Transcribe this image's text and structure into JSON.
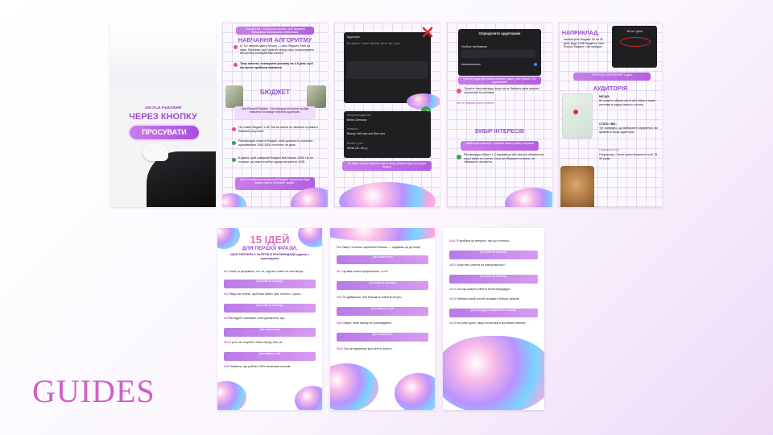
{
  "footer_title": "GUIDES",
  "card1": {
    "line1": "ЗАПУСК РЕКЛАМИ",
    "line2": "ЧЕРЕЗ КНОПКУ",
    "button": "ПРОСУВАТИ"
  },
  "card2": {
    "top_pill": "Сьогодні ми з тобою розглянемо, щоб кампанія працювала максимально ефективно",
    "heading1": "НАВЧАННЯ АЛГОРИТМУ",
    "item1": "A. Тут звернім увагу на ціну — ціна, бюджет, і вся ця сума. Можливо, щоб довгий період часу налаштування алгоритму показуватиме оплату.",
    "item2": "Тому змінити, показувати рекламу на 4-5 днів, щоб алгоритм пройшов навчання.",
    "heading2": "БЮДЖЕТ",
    "note": "Чим більший бюджет - тим швидше алгоритм пройде навчання та знайде потрібну аудиторію.",
    "item3": "Не ставте бюджет 1-2$. Так ви ніколи не зможете отримати бажаний результат.",
    "item4": "Рекомендую ставити бюджет, який дозволить отримати щонайменше 1500-3000 охоплень на день.",
    "item5": "В ідеалі, щоб сумарний бюджет був більше 100$. Це не означає, що вам потрібно одразу витратити 100$.",
    "bottom_pill": "Коли ти обираєш мінімальний бюджет, алгоритму буде важко знайти потрібних людей."
  },
  "card3": {
    "panel1_label": "Аудиторія",
    "panel1_text": "Всі країни, тільки Україна, міста, вік, стать",
    "panel2_label": "Місцезнаходження",
    "panel2_value": "Berlin, Germany",
    "panel2_label2": "Інтереси",
    "panel2_value2": "Beauty, Self care and Skin care",
    "panel2_label3": "Вікова група",
    "panel2_value3": "Жінки (20–35 р.)",
    "bottom_pill": "Не варто налаштовувати таргет, якщо цільова аудиторія дуже вузька"
  },
  "card4": {
    "screen_title": "Определите аудиторию",
    "screen_option1": "Особые требования",
    "screen_option2": "Автоматически",
    "pill1": "Цей тип аудиторії можна вибрати, якщо у вас більше 100 підписників.",
    "warn": "Тільки в тому випадку, якщо ви не бажаєте дати широке охоплення та рекламу.",
    "purple_note": "Ми не радимо цього робити.",
    "heading": "ВИБІР ІНТЕРЕСІВ",
    "pill2": "Найбільша помилка – обирати багато різних інтересів",
    "item": "Рекомендую обрати 1-2 параметри або взагалі обмежитись лише віком та статтю. Коли ви обираєте інтереси, ви обмежуєте алгоритм."
  },
  "card5": {
    "heading1": "НАПРИКЛАД,",
    "text1": "налаштуйте бюджет 1$ на 30 днів. Буде 100$ бюджету. Чим більше бюджет, тим швидше.",
    "phone_text": "1$ на 1 день",
    "pill": "ПРОГНОЗ ОХОПЛЕННЯ 1 день",
    "heading2": "АУДИТОРІЯ",
    "label1": "МІСЦЯ:",
    "text2": "Ви можете обрати місто або обрати показ реклами в радіусі вашого салону.",
    "label2": "СТАТЬ І ВІК:",
    "text3": "Тут очевидно, що вибираєте параметри, які цікавлять вашу аудиторію.",
    "sub_label": "Параметри ЦА:",
    "text4": "Наприклад: Салон краси бровиста та вії 25-35 років."
  },
  "card6": {
    "title_num": "15 ІДЕЙ",
    "title_sub": "ДЛЯ ПЕРШОЇ ФРАЗИ,",
    "subtitle": "ЩОБ ТВІЙ REELS ЗАЛЕТІВ В РЕКОМЕНДАЦІЇ (одразу з прикладами)",
    "rows": [
      {
        "num": "№1",
        "text": "Коли ти зрозумієш, хто ти, тоді все стане на свої місця..."
      },
      {
        "num": "№2",
        "text": "Якщо ви хочете, щоб ваш бізнес зріс, почніть з цього..."
      },
      {
        "num": "№3",
        "text": "Ви будете шоковані, коли дізнаєтеся, що..."
      },
      {
        "num": "№4",
        "text": "3 речі, які потрібно знати перед тим, як..."
      },
      {
        "num": "№5",
        "text": "Помилка, яку роблять 90% власників салонів"
      }
    ],
    "pills": [
      "Для майстра перукаря",
      "Для майстра манікюру",
      "Для косметолога",
      "Для майстра з вій"
    ]
  },
  "card7": {
    "rows": [
      {
        "num": "№6",
        "text": "Якщо ти хочеш заробляти більше — подивись це до кінця"
      },
      {
        "num": "№7",
        "text": "Це вміє кожен професіонал, а ти?"
      },
      {
        "num": "№8",
        "text": "Ти здивуєшся, але більшість клієнтів хочуть..."
      },
      {
        "num": "№9",
        "text": "Секрет, який нікому не розповідають"
      },
      {
        "num": "№10",
        "text": "Ось як змінилося моє життя, коли я..."
      }
    ],
    "pills": [
      "Для косметолога",
      "Для майстра манікюру",
      "Для майстра з брів",
      "Для косметолога"
    ]
  },
  "card8": {
    "rows": [
      {
        "num": "№11",
        "text": "Я зробила це вперше і ось що сталося..."
      },
      {
        "num": "№12",
        "text": "Чому твої клієнти не повертаються?"
      },
      {
        "num": "№13",
        "text": "Ось що кажуть клієнти після процедури"
      },
      {
        "num": "№14",
        "text": "Найпростіший спосіб отримати більше записів"
      },
      {
        "num": "№15",
        "text": "Не роби цього, якщо хочеш мати постійних клієнтів"
      }
    ],
    "pills": [
      "Для майстра перукаря",
      "Для майстра манікюру",
      "Для процедур перманентного макіяжу"
    ]
  },
  "colors": {
    "accent": "#b45fe0",
    "accent_light": "#f1dcfb",
    "heading": "#9b4fd1",
    "guides": "#cf5fc8"
  }
}
